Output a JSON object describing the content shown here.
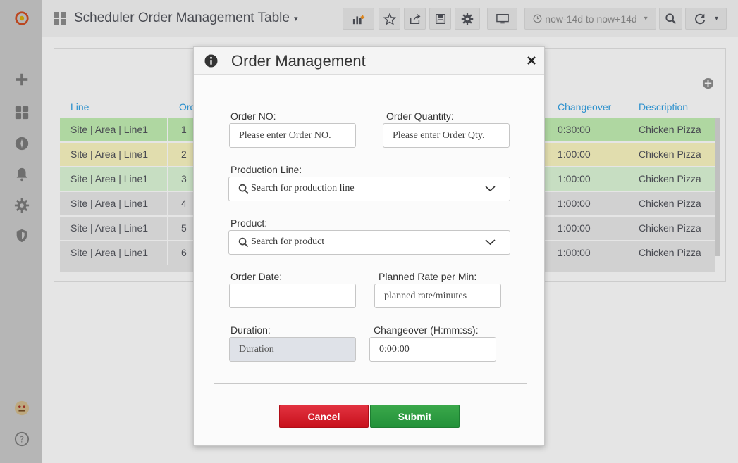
{
  "colors": {
    "row_green": "#c3f0b4",
    "row_yellow": "#fbf6c2",
    "row_light_green": "#def8d8",
    "row_gray": "#e9e9e9",
    "header_link": "#33a2e5",
    "cancel_red": "#d41f2a",
    "submit_green": "#2ea043"
  },
  "sidebar": {
    "icons": [
      "grafana-logo-icon",
      "plus-icon",
      "dashboards-icon",
      "explore-compass-icon",
      "bell-alert-icon",
      "gear-config-icon",
      "shield-icon",
      "user-avatar-icon",
      "help-icon"
    ]
  },
  "navbar": {
    "title": "Scheduler Order Management Table",
    "time_range": "now-14d to now+14d"
  },
  "table": {
    "headers": {
      "line": "Line",
      "order": "Ord",
      "changeover": "Changeover",
      "description": "Description"
    },
    "rows": [
      {
        "line": "Site | Area | Line1",
        "order": "1",
        "changeover": "0:30:00",
        "description": "Chicken Pizza",
        "color": "#c3f0b4"
      },
      {
        "line": "Site | Area | Line1",
        "order": "2",
        "changeover": "1:00:00",
        "description": "Chicken Pizza",
        "color": "#fbf6c2"
      },
      {
        "line": "Site | Area | Line1",
        "order": "3",
        "changeover": "1:00:00",
        "description": "Chicken Pizza",
        "color": "#def8d8"
      },
      {
        "line": "Site | Area | Line1",
        "order": "4",
        "changeover": "1:00:00",
        "description": "Chicken Pizza",
        "color": "#e9e9e9"
      },
      {
        "line": "Site | Area | Line1",
        "order": "5",
        "changeover": "1:00:00",
        "description": "Chicken Pizza",
        "color": "#e9e9e9"
      },
      {
        "line": "Site | Area | Line1",
        "order": "6",
        "changeover": "1:00:00",
        "description": "Chicken Pizza",
        "color": "#e9e9e9"
      }
    ]
  },
  "modal": {
    "title": "Order Management",
    "order_no": {
      "label": "Order NO:",
      "placeholder": "Please enter Order NO."
    },
    "order_qty": {
      "label": "Order Quantity:",
      "placeholder": "Please enter Order Qty."
    },
    "production_line": {
      "label": "Production Line:",
      "placeholder": "Search for production line"
    },
    "product": {
      "label": "Product:",
      "placeholder": "Search for product"
    },
    "order_date": {
      "label": "Order Date:",
      "value": ""
    },
    "planned_rate": {
      "label": "Planned Rate per Min:",
      "placeholder": "planned rate/minutes"
    },
    "duration": {
      "label": "Duration:",
      "placeholder": "Duration"
    },
    "changeover": {
      "label": "Changeover (H:mm:ss):",
      "value": "0:00:00"
    },
    "cancel_label": "Cancel",
    "submit_label": "Submit"
  }
}
